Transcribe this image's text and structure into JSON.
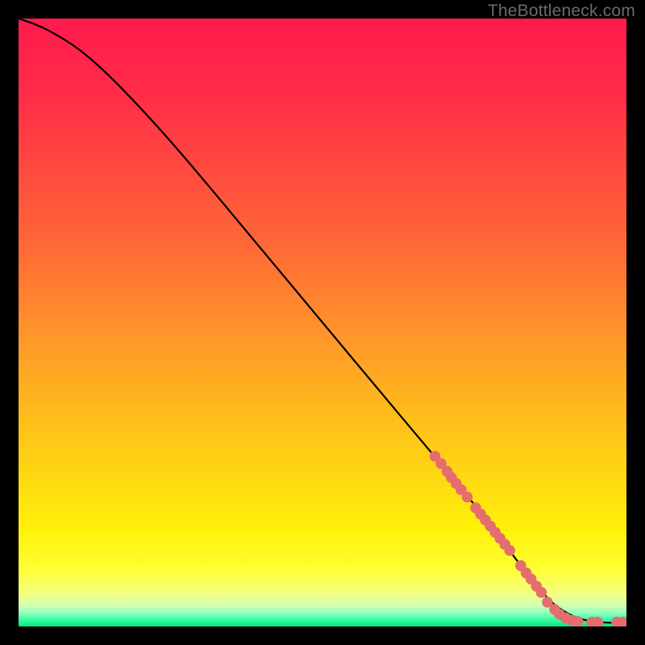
{
  "watermark": "TheBottleneck.com",
  "colors": {
    "dot": "#e46e6e",
    "line": "#000000",
    "gradient_stops": [
      {
        "pos": 0.0,
        "c": "#ff1a4e"
      },
      {
        "pos": 0.12,
        "c": "#ff2c47"
      },
      {
        "pos": 0.25,
        "c": "#ff4a3f"
      },
      {
        "pos": 0.38,
        "c": "#ff6a36"
      },
      {
        "pos": 0.5,
        "c": "#ff8f2c"
      },
      {
        "pos": 0.62,
        "c": "#ffb31f"
      },
      {
        "pos": 0.74,
        "c": "#ffd413"
      },
      {
        "pos": 0.84,
        "c": "#fff00a"
      },
      {
        "pos": 0.905,
        "c": "#ffff33"
      },
      {
        "pos": 0.945,
        "c": "#f6ff80"
      },
      {
        "pos": 0.965,
        "c": "#d4ffb0"
      },
      {
        "pos": 0.978,
        "c": "#8fffbf"
      },
      {
        "pos": 0.988,
        "c": "#3dffa3"
      },
      {
        "pos": 1.0,
        "c": "#00e884"
      }
    ]
  },
  "chart_data": {
    "type": "line",
    "title": "",
    "xlabel": "",
    "ylabel": "",
    "xlim": [
      0,
      100
    ],
    "ylim": [
      0,
      100
    ],
    "grid": false,
    "series": [
      {
        "name": "curve",
        "x": [
          0,
          3,
          6,
          10,
          14,
          18,
          24,
          30,
          40,
          50,
          60,
          68,
          73,
          77,
          80,
          83,
          85,
          88,
          92,
          96,
          100
        ],
        "y": [
          100,
          99,
          97.5,
          95,
          91.5,
          87.5,
          81,
          74,
          62,
          50,
          38,
          28.5,
          22.5,
          17.5,
          13.5,
          9.5,
          7,
          3.5,
          1.2,
          0.6,
          0.6
        ]
      }
    ],
    "points": [
      {
        "name": "cluster-upper",
        "x": [
          68.5,
          69.5,
          70.5,
          71.2,
          72.0,
          72.8,
          73.8
        ],
        "y": [
          28.0,
          26.8,
          25.5,
          24.5,
          23.5,
          22.5,
          21.3
        ]
      },
      {
        "name": "cluster-mid",
        "x": [
          75.2,
          76.0,
          76.8,
          77.6,
          78.4,
          79.2,
          80.0,
          80.8
        ],
        "y": [
          19.5,
          18.5,
          17.5,
          16.5,
          15.5,
          14.5,
          13.5,
          12.5
        ]
      },
      {
        "name": "cluster-low",
        "x": [
          82.6,
          83.5,
          84.3,
          85.2,
          86.0
        ],
        "y": [
          10.0,
          8.8,
          7.8,
          6.6,
          5.6
        ]
      },
      {
        "name": "cluster-flat1",
        "x": [
          87.0,
          88.2,
          89.0,
          90.0,
          91.0,
          92.0
        ],
        "y": [
          4.0,
          2.8,
          2.0,
          1.4,
          1.0,
          0.8
        ]
      },
      {
        "name": "cluster-flat2",
        "x": [
          94.3,
          95.3
        ],
        "y": [
          0.7,
          0.7
        ]
      },
      {
        "name": "cluster-flat3",
        "x": [
          98.4,
          99.4
        ],
        "y": [
          0.7,
          0.7
        ]
      }
    ]
  }
}
